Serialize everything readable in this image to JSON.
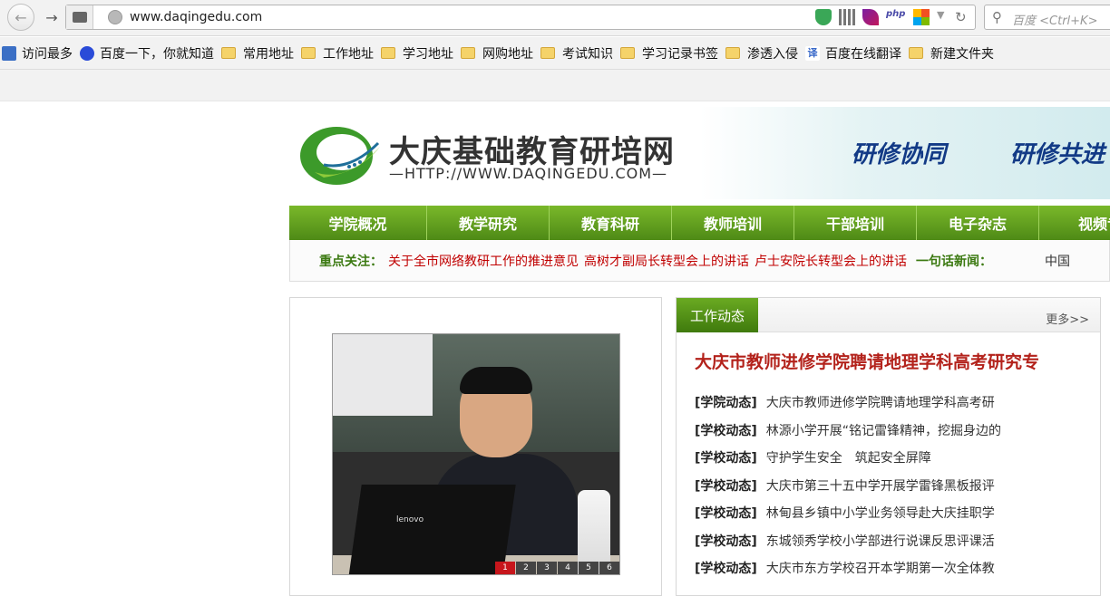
{
  "browser": {
    "url": "www.daqingedu.com",
    "search_placeholder": "百度 <Ctrl+K>",
    "php_label": "php"
  },
  "bookmarks": [
    {
      "label": "访问最多",
      "icon": "search-icon"
    },
    {
      "label": "百度一下，你就知道",
      "icon": "paw-icon"
    },
    {
      "label": "常用地址",
      "icon": "folder-icon"
    },
    {
      "label": "工作地址",
      "icon": "folder-icon"
    },
    {
      "label": "学习地址",
      "icon": "folder-icon"
    },
    {
      "label": "网购地址",
      "icon": "folder-icon"
    },
    {
      "label": "考试知识",
      "icon": "folder-icon"
    },
    {
      "label": "学习记录书签",
      "icon": "folder-icon"
    },
    {
      "label": "渗透入侵",
      "icon": "folder-icon"
    },
    {
      "label": "百度在线翻译",
      "icon": "translate-icon"
    },
    {
      "label": "新建文件夹",
      "icon": "folder-icon"
    }
  ],
  "site": {
    "title": "大庆基础教育研培网",
    "url_banner": "—HTTP://WWW.DAQINGEDU.COM—",
    "slogan_1": "研修协同",
    "slogan_2": "研修共进",
    "menu": [
      "学院概况",
      "教学研究",
      "教育科研",
      "教师培训",
      "干部培训",
      "电子杂志",
      "视频专"
    ],
    "focus": {
      "label": "重点关注：",
      "links": [
        "关于全市网络教研工作的推进意见",
        "高树才副局长转型会上的讲话",
        "卢士安院长转型会上的讲话"
      ],
      "news_label": "一句话新闻：",
      "ticker": "中国"
    },
    "slide": {
      "laptop_brand": "lenovo",
      "pages": [
        "1",
        "2",
        "3",
        "4",
        "5",
        "6"
      ],
      "active_page": "1"
    },
    "news": {
      "tab": "工作动态",
      "more": "更多>>",
      "headline": "大庆市教师进修学院聘请地理学科高考研究专",
      "items": [
        {
          "category": "[学院动态]",
          "title": "大庆市教师进修学院聘请地理学科高考研"
        },
        {
          "category": "[学校动态]",
          "title": "林源小学开展“铭记雷锋精神，挖掘身边的"
        },
        {
          "category": "[学校动态]",
          "title": "守护学生安全　筑起安全屏障"
        },
        {
          "category": "[学校动态]",
          "title": "大庆市第三十五中学开展学雷锋黑板报评"
        },
        {
          "category": "[学校动态]",
          "title": "林甸县乡镇中小学业务领导赴大庆挂职学"
        },
        {
          "category": "[学校动态]",
          "title": "东城领秀学校小学部进行说课反思评课活"
        },
        {
          "category": "[学校动态]",
          "title": "大庆市东方学校召开本学期第一次全体教"
        }
      ]
    }
  },
  "colors": {
    "menu_green": "#5a9a1c",
    "focus_red": "#c00000",
    "headline_red": "#b3221b",
    "slogan_blue": "#123a86"
  }
}
